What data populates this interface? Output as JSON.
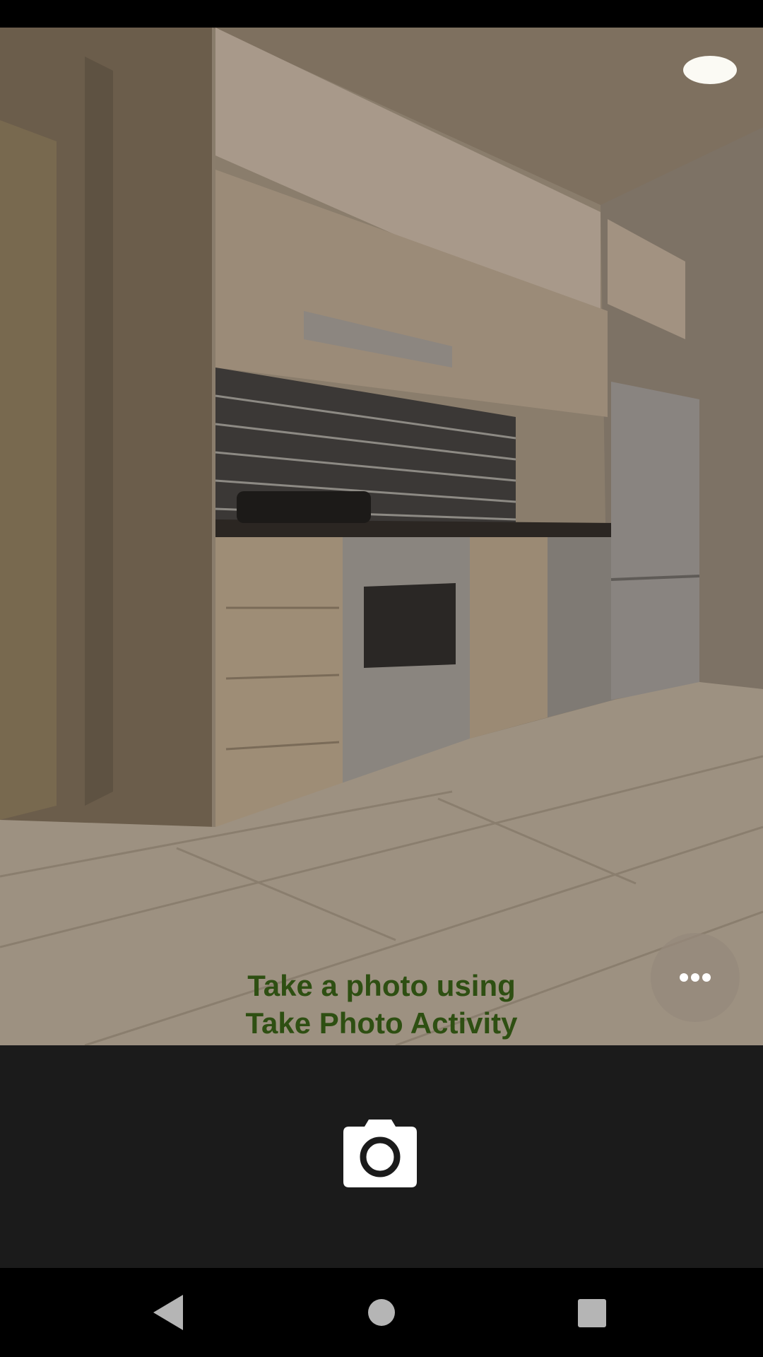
{
  "hint": {
    "line1": "Take a photo using",
    "line2": "Take Photo Activity"
  },
  "icons": {
    "more": "more-horizontal-icon",
    "shutter": "camera-icon",
    "back": "back-triangle-icon",
    "home": "home-circle-icon",
    "recents": "recents-square-icon"
  },
  "colors": {
    "hint_text": "#2e4f12",
    "panel": "#1b1b1b",
    "nav_icons": "#b5b5b5"
  }
}
